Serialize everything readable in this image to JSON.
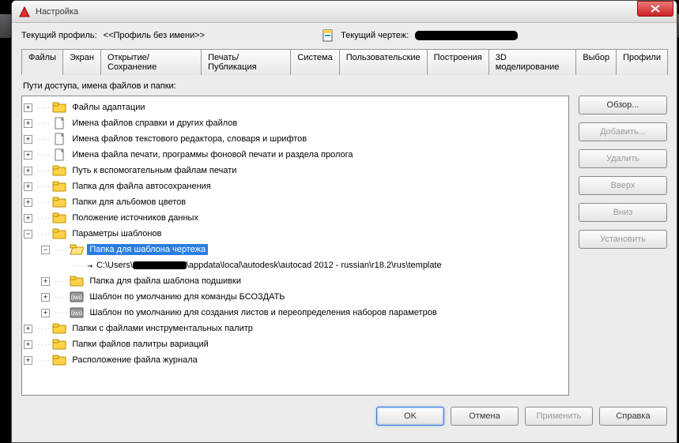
{
  "window": {
    "title": "Настройка"
  },
  "profile": {
    "label": "Текущий профиль:",
    "value": "<<Профиль без имени>>",
    "drawing_label": "Текущий чертеж:"
  },
  "tabs": [
    "Файлы",
    "Экран",
    "Открытие/Сохранение",
    "Печать/Публикация",
    "Система",
    "Пользовательские",
    "Построения",
    "3D моделирование",
    "Выбор",
    "Профили"
  ],
  "active_tab_index": 0,
  "section_label": "Пути доступа, имена файлов и папки:",
  "tree": [
    {
      "icon": "folder",
      "label": "Файлы адаптации",
      "exp": "+"
    },
    {
      "icon": "file",
      "label": "Имена файлов справки и других файлов",
      "exp": "+"
    },
    {
      "icon": "file",
      "label": "Имена файлов текстового редактора, словаря и шрифтов",
      "exp": "+"
    },
    {
      "icon": "file",
      "label": "Имена файла печати, программы фоновой печати и раздела пролога",
      "exp": "+"
    },
    {
      "icon": "folder",
      "label": "Путь к вспомогательным файлам печати",
      "exp": "+"
    },
    {
      "icon": "folder",
      "label": "Папка для файла автосохранения",
      "exp": "+"
    },
    {
      "icon": "folder",
      "label": "Папки для альбомов цветов",
      "exp": "+"
    },
    {
      "icon": "folder",
      "label": "Положение источников данных",
      "exp": "+"
    },
    {
      "icon": "folder",
      "label": "Параметры шаблонов",
      "exp": "-",
      "children": [
        {
          "icon": "folder-open",
          "label": "Папка для шаблона чертежа",
          "exp": "-",
          "selected": true,
          "children": [
            {
              "icon": "arrow",
              "path_pre": "C:\\Users\\",
              "path_post": "\\appdata\\local\\autodesk\\autocad 2012 - russian\\r18.2\\rus\\template"
            }
          ]
        },
        {
          "icon": "folder",
          "label": "Папка для файла шаблона подшивки",
          "exp": "+"
        },
        {
          "icon": "dwg",
          "label": "Шаблон по умолчанию для команды БСОЗДАТЬ",
          "exp": "+"
        },
        {
          "icon": "dwg",
          "label": "Шаблон по умолчанию для создания листов и переопределения наборов параметров",
          "exp": "+"
        }
      ]
    },
    {
      "icon": "folder",
      "label": "Папки с файлами инструментальных палитр",
      "exp": "+"
    },
    {
      "icon": "folder",
      "label": "Папки файлов палитры вариаций",
      "exp": "+"
    },
    {
      "icon": "folder",
      "label": "Расположение файла журнала",
      "exp": "+"
    }
  ],
  "side_buttons": {
    "browse": "Обзор...",
    "add": "Добавить...",
    "delete": "Удалить",
    "up": "Вверх",
    "down": "Вниз",
    "set": "Установить"
  },
  "bottom_buttons": {
    "ok": "OK",
    "cancel": "Отмена",
    "apply": "Применить",
    "help": "Справка"
  }
}
